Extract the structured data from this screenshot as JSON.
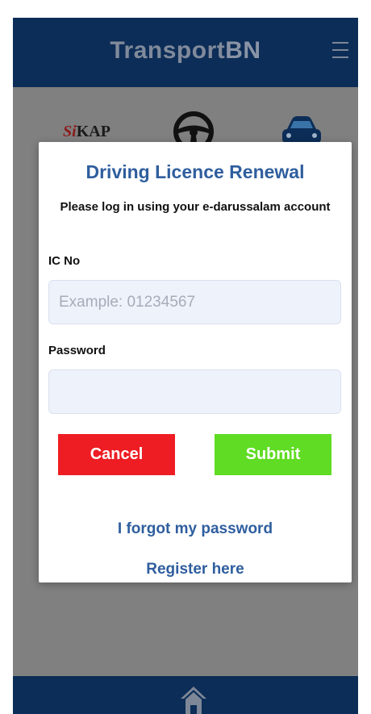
{
  "app": {
    "logo_part1": "Transport",
    "logo_part2": "BN",
    "menu_icon": "hamburger-menu-icon"
  },
  "services": {
    "sikap_prefix": "Si",
    "sikap_suffix": "KAP",
    "icons": [
      "steering-wheel-icon",
      "car-icon"
    ]
  },
  "login_modal": {
    "title": "Driving Licence Renewal",
    "subtitle": "Please log in using your e-darussalam account",
    "ic_label": "IC No",
    "ic_placeholder": "Example: 01234567",
    "ic_value": "",
    "password_label": "Password",
    "password_value": "",
    "cancel_label": "Cancel",
    "submit_label": "Submit",
    "forgot_link": "I forgot my password",
    "register_link": "Register here"
  },
  "bottom_nav": {
    "icon": "home-icon"
  },
  "colors": {
    "header_bg": "#0c2d57",
    "overlay_bg": "#808080",
    "title_blue": "#2f5e9e",
    "cancel_red": "#ee1d24",
    "submit_green": "#5fdc23",
    "field_bg": "#eef2fb"
  }
}
